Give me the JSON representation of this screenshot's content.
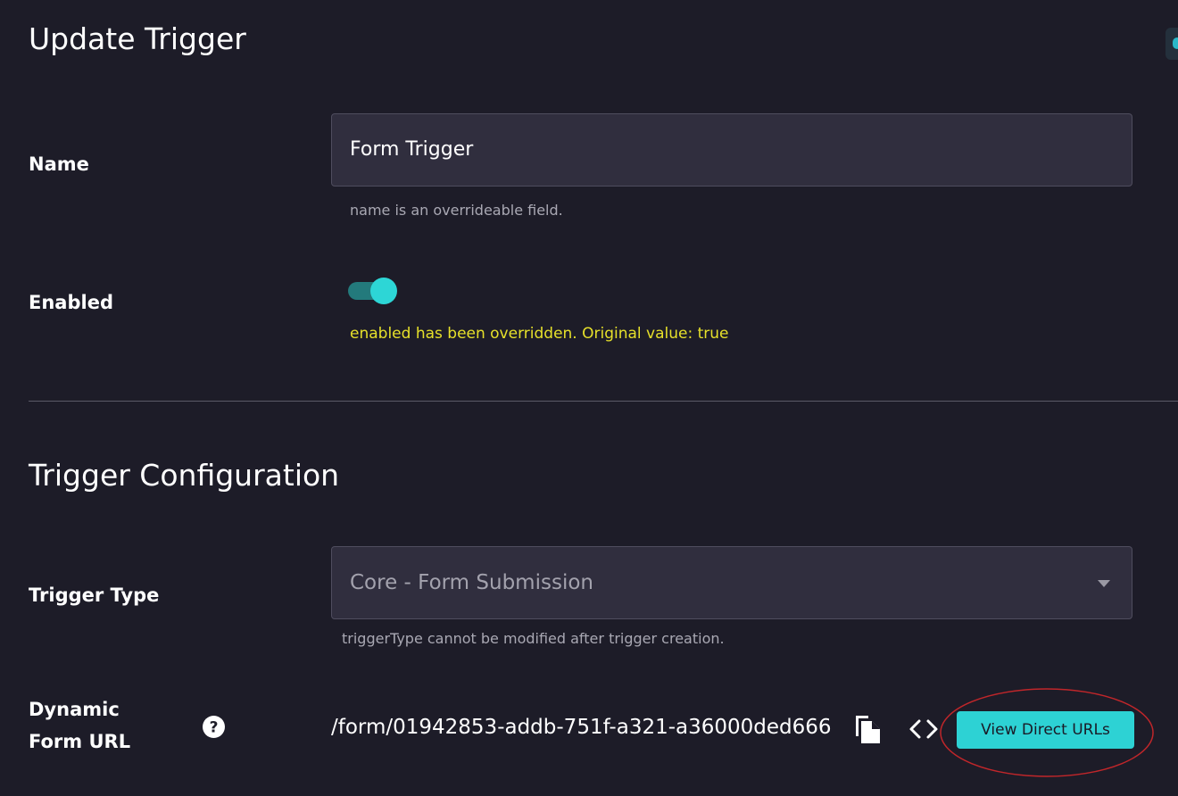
{
  "header": {
    "title": "Update Trigger"
  },
  "name_field": {
    "label": "Name",
    "value": "Form Trigger",
    "helper": "name is an overrideable field."
  },
  "enabled_field": {
    "label": "Enabled",
    "checked": true,
    "helper": "enabled has been overridden. Original value: true"
  },
  "config": {
    "title": "Trigger Configuration",
    "trigger_type": {
      "label": "Trigger Type",
      "value": "Core - Form Submission",
      "helper": "triggerType cannot be modified after trigger creation."
    },
    "dynamic_url": {
      "label_line1": "Dynamic",
      "label_line2": "Form URL",
      "value": "/form/01942853-addb-751f-a321-a36000ded666",
      "button_label": "View Direct URLs"
    }
  },
  "icons": {
    "help": "help-icon",
    "copy": "copy-icon",
    "code": "code-icon",
    "dropdown": "chevron-down-icon"
  },
  "colors": {
    "background": "#1d1c28",
    "input_background": "#302e3e",
    "accent": "#2dd2d4",
    "toggle_track": "#237a7c",
    "warning_text": "#e6e02a",
    "helper_text": "#a9a8b3",
    "annotation": "#c0262a"
  }
}
